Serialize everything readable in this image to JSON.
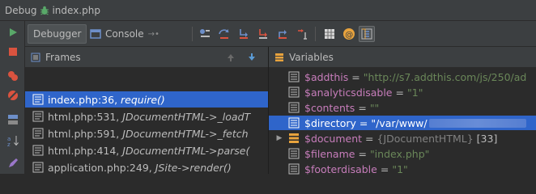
{
  "window": {
    "prefix": "Debug",
    "file": "index.php"
  },
  "toolbar": {
    "tabs": [
      {
        "label": "Debugger",
        "pin": "→•"
      },
      {
        "label": "Console",
        "pin": "→•"
      }
    ]
  },
  "frames": {
    "title": "Frames",
    "items": [
      {
        "file": "index.php:36,",
        "func": "require()"
      },
      {
        "file": "html.php:531,",
        "func": "JDocumentHTML->_loadT"
      },
      {
        "file": "html.php:591,",
        "func": "JDocumentHTML->_fetch"
      },
      {
        "file": "html.php:414,",
        "func": "JDocumentHTML->parse("
      },
      {
        "file": "application.php:249,",
        "func": "JSite->render()"
      }
    ]
  },
  "variables": {
    "title": "Variables",
    "items": [
      {
        "name": "$addthis",
        "value": "\"http://s7.addthis.com/js/250/ad"
      },
      {
        "name": "$analyticsdisable",
        "value": "\"1\""
      },
      {
        "name": "$contents",
        "value": "\"\""
      },
      {
        "name": "$directory",
        "value": "\"/var/www/"
      },
      {
        "name": "$document",
        "value": "{JDocumentHTML}",
        "count": "[33]"
      },
      {
        "name": "$filename",
        "value": "\"index.php\""
      },
      {
        "name": "$footerdisable",
        "value": "\"1\""
      }
    ]
  },
  "colors": {
    "accent": "#2f65ca",
    "varname": "#c77dbb",
    "string": "#6a8759"
  }
}
